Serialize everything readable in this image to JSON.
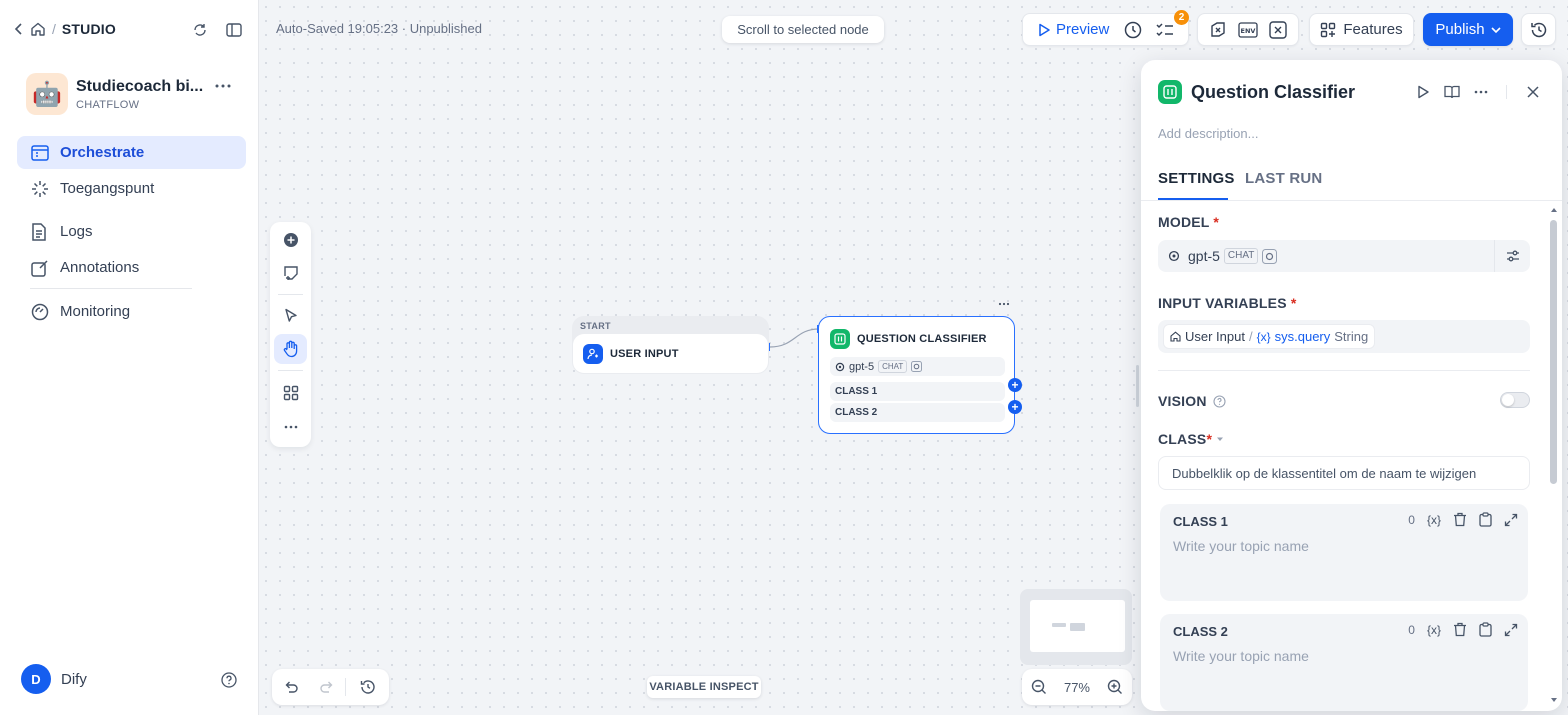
{
  "breadcrumb": {
    "section": "STUDIO"
  },
  "app": {
    "avatar": "🤖",
    "name": "Studiecoach bi...",
    "type": "CHATFLOW"
  },
  "nav": [
    {
      "label": "Orchestrate",
      "icon": "layout-icon",
      "active": true
    },
    {
      "label": "Toegangspunt",
      "icon": "access-point-icon"
    },
    {
      "label": "Logs",
      "icon": "logs-icon"
    },
    {
      "label": "Annotations",
      "icon": "annotations-icon"
    },
    {
      "label": "Monitoring",
      "icon": "monitoring-icon"
    }
  ],
  "user": {
    "initial": "D",
    "name": "Dify"
  },
  "toolbar": {
    "status": "Auto-Saved 19:05:23 · Unpublished",
    "scroll_to_selected": "Scroll to selected node",
    "preview": "Preview",
    "checklist_badge": "2",
    "env_label": "ENV",
    "features": "Features",
    "publish": "Publish"
  },
  "nodes": {
    "start": {
      "section": "START",
      "title": "USER INPUT"
    },
    "classifier": {
      "title": "QUESTION CLASSIFIER",
      "model": "gpt-5",
      "model_tag": "CHAT",
      "classes": [
        "CLASS 1",
        "CLASS 2"
      ]
    }
  },
  "bottom": {
    "variable_inspect": "VARIABLE INSPECT",
    "zoom": "77%"
  },
  "panel": {
    "title": "Question Classifier",
    "description_placeholder": "Add description...",
    "tabs": [
      "SETTINGS",
      "LAST RUN"
    ],
    "model_label": "MODEL",
    "model_name": "gpt-5",
    "model_tag": "CHAT",
    "input_label": "INPUT VARIABLES",
    "input_var": {
      "node": "User Input",
      "sep": "/",
      "var_icon": "{x}",
      "name": "sys.query",
      "type": "String"
    },
    "vision_label": "VISION",
    "class_label": "CLASS",
    "class_hint": "Dubbelklik op de klassentitel om de naam te wijzigen",
    "classes": [
      {
        "title": "CLASS 1",
        "count": "0",
        "placeholder": "Write your topic name"
      },
      {
        "title": "CLASS 2",
        "count": "0",
        "placeholder": "Write your topic name"
      }
    ],
    "var_button": "{x}"
  },
  "colors": {
    "accent": "#155eef",
    "classifier_green": "#12b76a",
    "active_bg": "#e4ebff"
  }
}
